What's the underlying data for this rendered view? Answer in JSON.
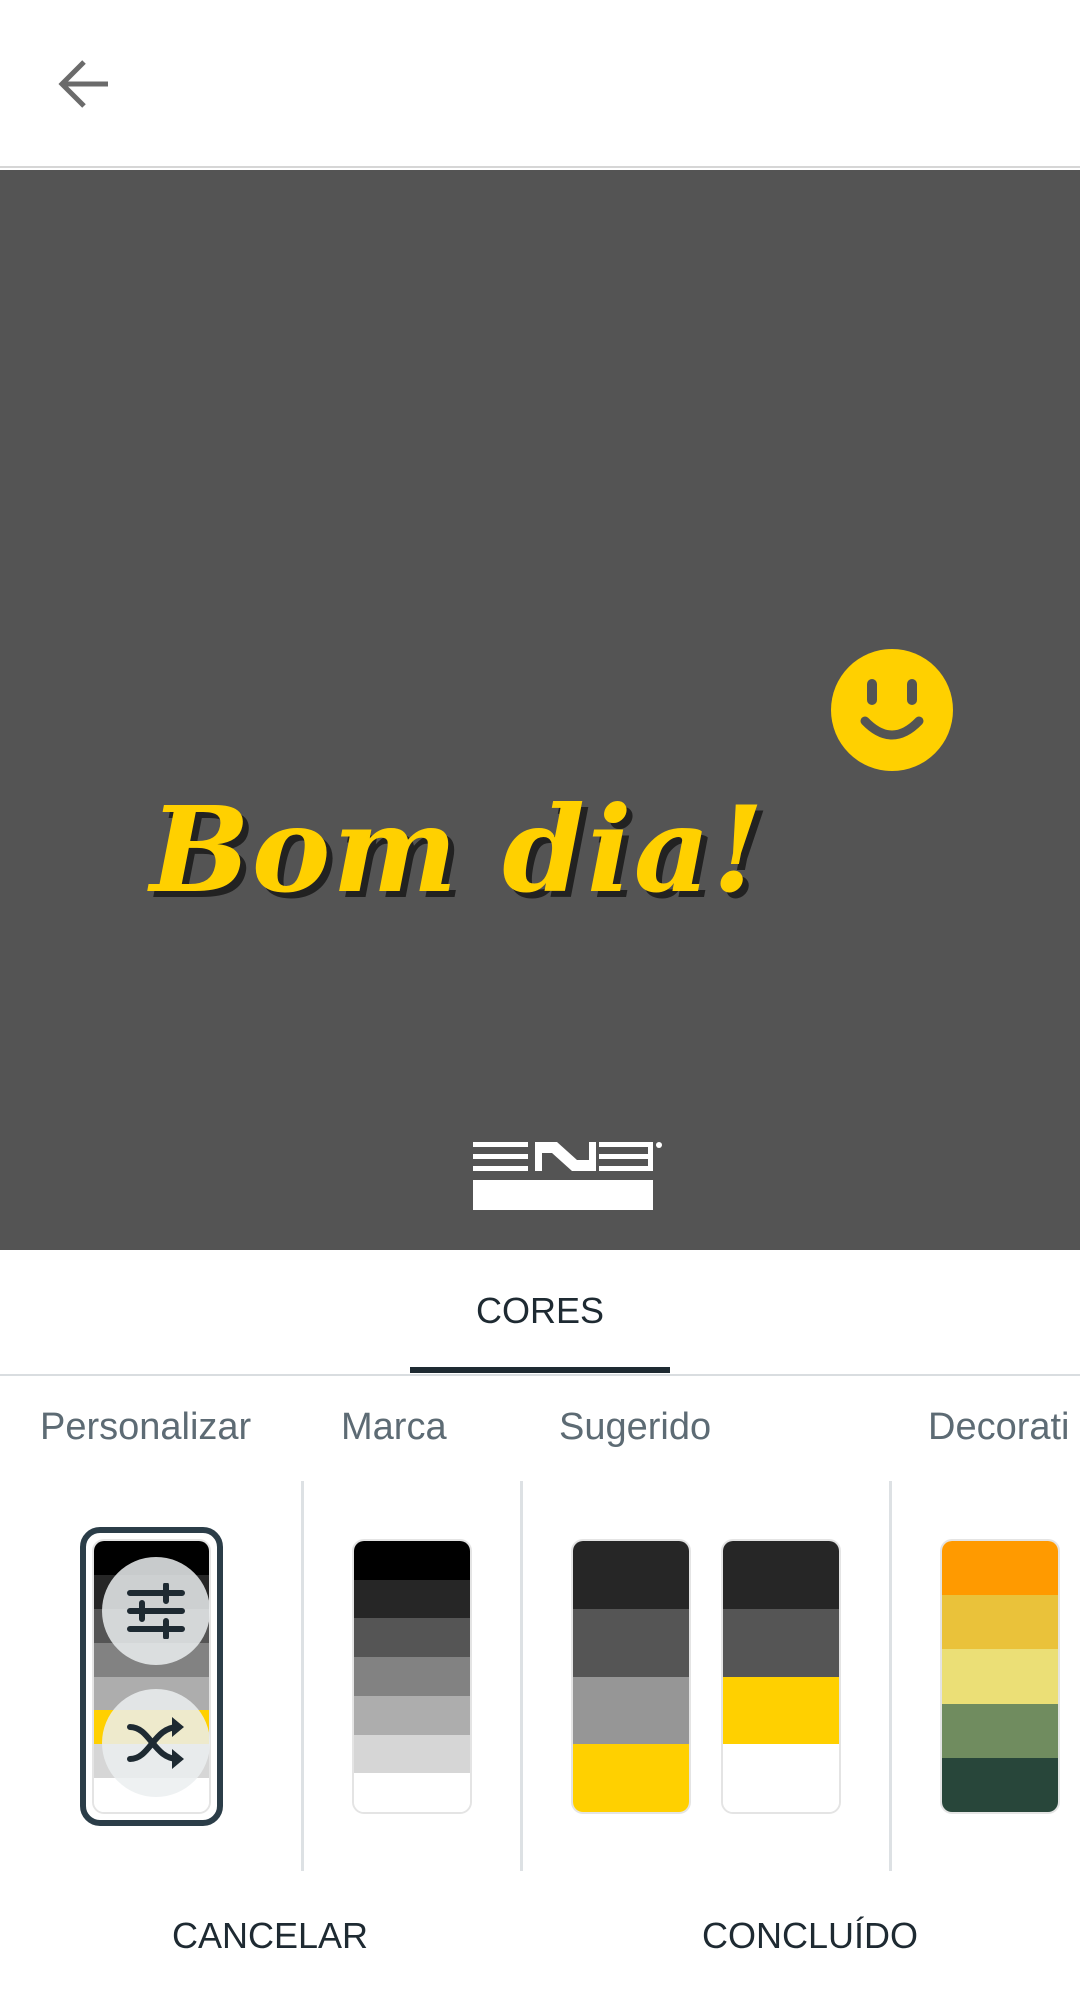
{
  "header": {
    "back_icon": "arrow-left-icon"
  },
  "canvas": {
    "background": "#545454",
    "headline": "Bom dia!",
    "headline_color": "#ffd000",
    "emoji_icon": "smiley-icon",
    "logo_label": "ENS"
  },
  "tabs": [
    {
      "label": "CORES",
      "active": true
    }
  ],
  "categories": [
    {
      "label": "Personalizar"
    },
    {
      "label": "Marca"
    },
    {
      "label": "Sugerido"
    },
    {
      "label": "Decorati"
    }
  ],
  "palettes": {
    "personalizar": [
      "#000000",
      "#262626",
      "#555555",
      "#828282",
      "#adadad",
      "#ffd000",
      "#d6d6d6",
      "#ffffff"
    ],
    "marca": [
      "#000000",
      "#262626",
      "#555555",
      "#828282",
      "#adadad",
      "#d6d6d6",
      "#ffffff"
    ],
    "sugerido_1": [
      "#262626",
      "#555555",
      "#969696",
      "#ffd000"
    ],
    "sugerido_2": [
      "#262626",
      "#555555",
      "#ffd000",
      "#ffffff"
    ],
    "decorativo": [
      "#ff9a00",
      "#eac23a",
      "#ebdf76",
      "#708c5f",
      "#28463a"
    ]
  },
  "icons": {
    "adjust": "sliders-icon",
    "shuffle": "shuffle-icon"
  },
  "footer": {
    "cancel": "CANCELAR",
    "done": "CONCLUÍDO"
  }
}
